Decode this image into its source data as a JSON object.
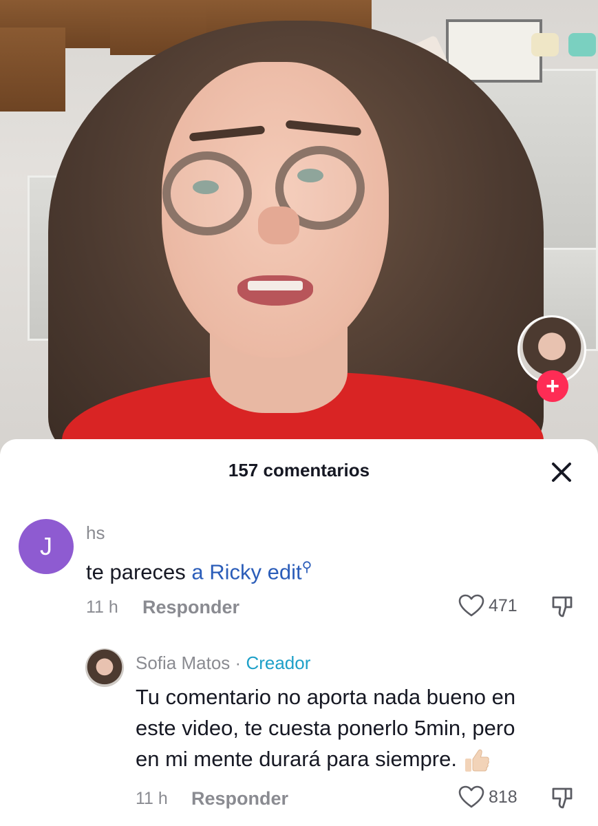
{
  "sheet": {
    "title": "157 comentarios"
  },
  "comments": [
    {
      "avatar_letter": "J",
      "avatar_color": "#8e5bd1",
      "username": "hs",
      "text_prefix": "te pareces ",
      "mention": "a Ricky edit",
      "time": "11 h",
      "reply_label": "Responder",
      "likes": "471"
    }
  ],
  "reply": {
    "username": "Sofia Matos",
    "separator": "·",
    "badge": "Creador",
    "lines": [
      "Tu comentario no aporta nada bueno en",
      "este video, te cuesta ponerlo 5min, pero",
      "en mi mente durará para siempre."
    ],
    "time": "11 h",
    "reply_label": "Responder",
    "likes": "818"
  },
  "follow_button": {
    "label": "+"
  },
  "icons": {
    "close": "close-icon",
    "like": "heart-icon",
    "dislike": "dislike-icon",
    "search": "search-icon",
    "emoji": "thumbs-up-emoji"
  },
  "colors": {
    "accent_follow": "#fe2c55",
    "mention": "#2b5db9",
    "creator_badge": "#1ea0c8",
    "muted_text": "#8a8b91"
  }
}
